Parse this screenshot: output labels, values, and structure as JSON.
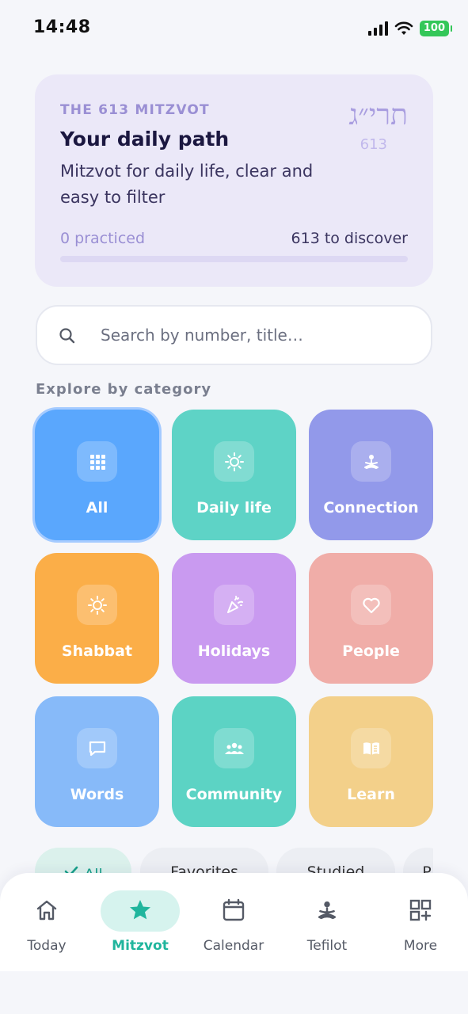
{
  "status_bar": {
    "time": "14:48",
    "battery": "100"
  },
  "hero": {
    "eyebrow": "THE 613 MITZVOT",
    "title": "Your daily path",
    "subtitle": "Mitzvot for daily life, clear and easy to filter",
    "hebrew": "תרי״ג",
    "count": "613",
    "practiced": "0 practiced",
    "to_discover": "613 to discover",
    "progress_fraction": 0
  },
  "search": {
    "placeholder": "Search by number, title…"
  },
  "section_label": "Explore by category",
  "categories": [
    {
      "label": "All",
      "icon": "grid-icon",
      "color": "#5aa7fd",
      "selected": true
    },
    {
      "label": "Daily life",
      "icon": "sun-icon",
      "color": "#5ed3c6"
    },
    {
      "label": "Connection",
      "icon": "meditation-icon",
      "color": "#9299ea"
    },
    {
      "label": "Shabbat",
      "icon": "sun-icon",
      "color": "#fbae48"
    },
    {
      "label": "Holidays",
      "icon": "party-icon",
      "color": "#c99af0"
    },
    {
      "label": "People",
      "icon": "heart-icon",
      "color": "#f0ada8"
    },
    {
      "label": "Words",
      "icon": "chat-icon",
      "color": "#87baf9"
    },
    {
      "label": "Community",
      "icon": "group-icon",
      "color": "#5cd3c4"
    },
    {
      "label": "Learn",
      "icon": "book-icon",
      "color": "#f3d08a"
    }
  ],
  "chips": [
    {
      "label": "All",
      "active": true
    },
    {
      "label": "Favorites"
    },
    {
      "label": "Studied"
    },
    {
      "label": "P"
    }
  ],
  "nav": [
    {
      "label": "Today",
      "icon": "home-icon"
    },
    {
      "label": "Mitzvot",
      "icon": "star-icon",
      "active": true
    },
    {
      "label": "Calendar",
      "icon": "calendar-icon"
    },
    {
      "label": "Tefilot",
      "icon": "meditation-icon"
    },
    {
      "label": "More",
      "icon": "grid-plus-icon"
    }
  ],
  "colors": {
    "accent": "#20b59d",
    "hero_bg": "#ebe8f8",
    "hero_accent": "#9a8fd4"
  }
}
